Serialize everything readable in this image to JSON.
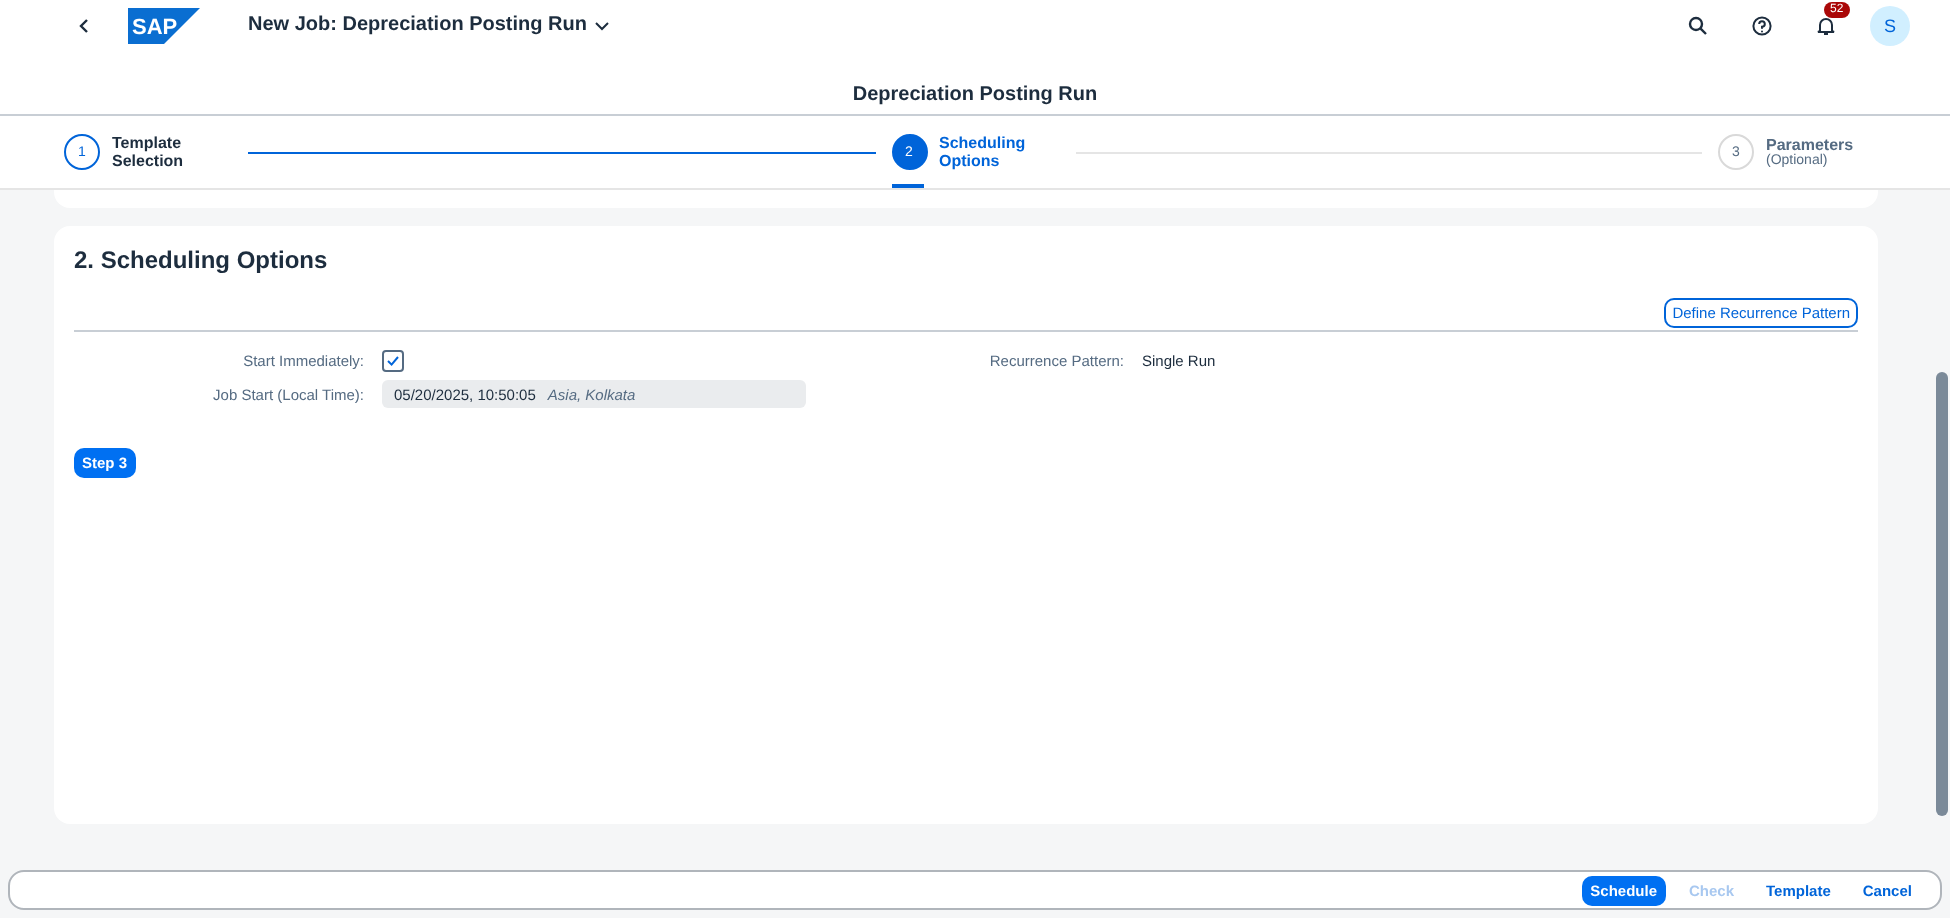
{
  "shell": {
    "logo": "SAP",
    "title": "New Job: Depreciation Posting Run",
    "notifications": "52",
    "avatar": "S"
  },
  "page_title": "Depreciation Posting Run",
  "steps": [
    {
      "number": "1",
      "label": "Template Selection",
      "selected": false
    },
    {
      "number": "2",
      "label": "Scheduling Options",
      "selected": true
    },
    {
      "number": "3",
      "label": "Parameters",
      "sublabel": "(Optional)",
      "selected": false
    }
  ],
  "section": {
    "title": "2. Scheduling Options",
    "define_button": "Define Recurrence Pattern",
    "start_immediately": {
      "label": "Start Immediately:",
      "checked": true
    },
    "job_start": {
      "label": "Job Start (Local Time):",
      "value": "05/20/2025, 10:50:05",
      "timezone": "Asia, Kolkata"
    },
    "recurrence": {
      "label": "Recurrence Pattern:",
      "value": "Single Run"
    },
    "next_button": "Step 3"
  },
  "footer": [
    {
      "label": "Schedule",
      "emphasized": true,
      "disabled": false
    },
    {
      "label": "Check",
      "emphasized": false,
      "disabled": true
    },
    {
      "label": "Template",
      "emphasized": false,
      "disabled": false
    },
    {
      "label": "Cancel",
      "emphasized": false,
      "disabled": false
    }
  ]
}
